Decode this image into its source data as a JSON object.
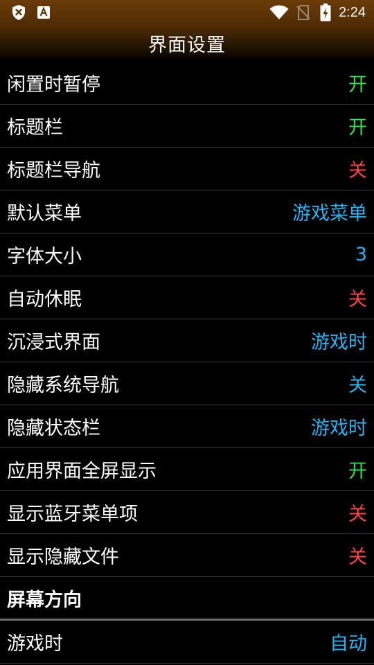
{
  "status_bar": {
    "time": "2:24",
    "icons": [
      "shield-x-icon",
      "font-a-icon",
      "wifi-icon",
      "no-sim-icon",
      "battery-charging-icon"
    ]
  },
  "header": {
    "title": "界面设置"
  },
  "colors": {
    "on": "#34e04c",
    "off": "#ff4545",
    "accent": "#2ab3f0",
    "header_brown": "#6a3c06"
  },
  "settings": [
    {
      "label": "闲置时暂停",
      "value": "开",
      "color": "#34e04c"
    },
    {
      "label": "标题栏",
      "value": "开",
      "color": "#34e04c"
    },
    {
      "label": "标题栏导航",
      "value": "关",
      "color": "#ff4545"
    },
    {
      "label": "默认菜单",
      "value": "游戏菜单",
      "color": "#2ab3f0"
    },
    {
      "label": "字体大小",
      "value": "3",
      "color": "#2ab3f0"
    },
    {
      "label": "自动休眠",
      "value": "关",
      "color": "#ff4545"
    },
    {
      "label": "沉浸式界面",
      "value": "游戏时",
      "color": "#2ab3f0"
    },
    {
      "label": "隐藏系统导航",
      "value": "关",
      "color": "#2ab3f0"
    },
    {
      "label": "隐藏状态栏",
      "value": "游戏时",
      "color": "#2ab3f0"
    },
    {
      "label": "应用界面全屏显示",
      "value": "开",
      "color": "#34e04c"
    },
    {
      "label": "显示蓝牙菜单项",
      "value": "关",
      "color": "#ff4545"
    },
    {
      "label": "显示隐藏文件",
      "value": "关",
      "color": "#ff4545"
    }
  ],
  "section_screen_orientation": {
    "title": "屏幕方向"
  },
  "orientation_settings": [
    {
      "label": "游戏时",
      "value": "自动",
      "color": "#2ab3f0"
    }
  ]
}
